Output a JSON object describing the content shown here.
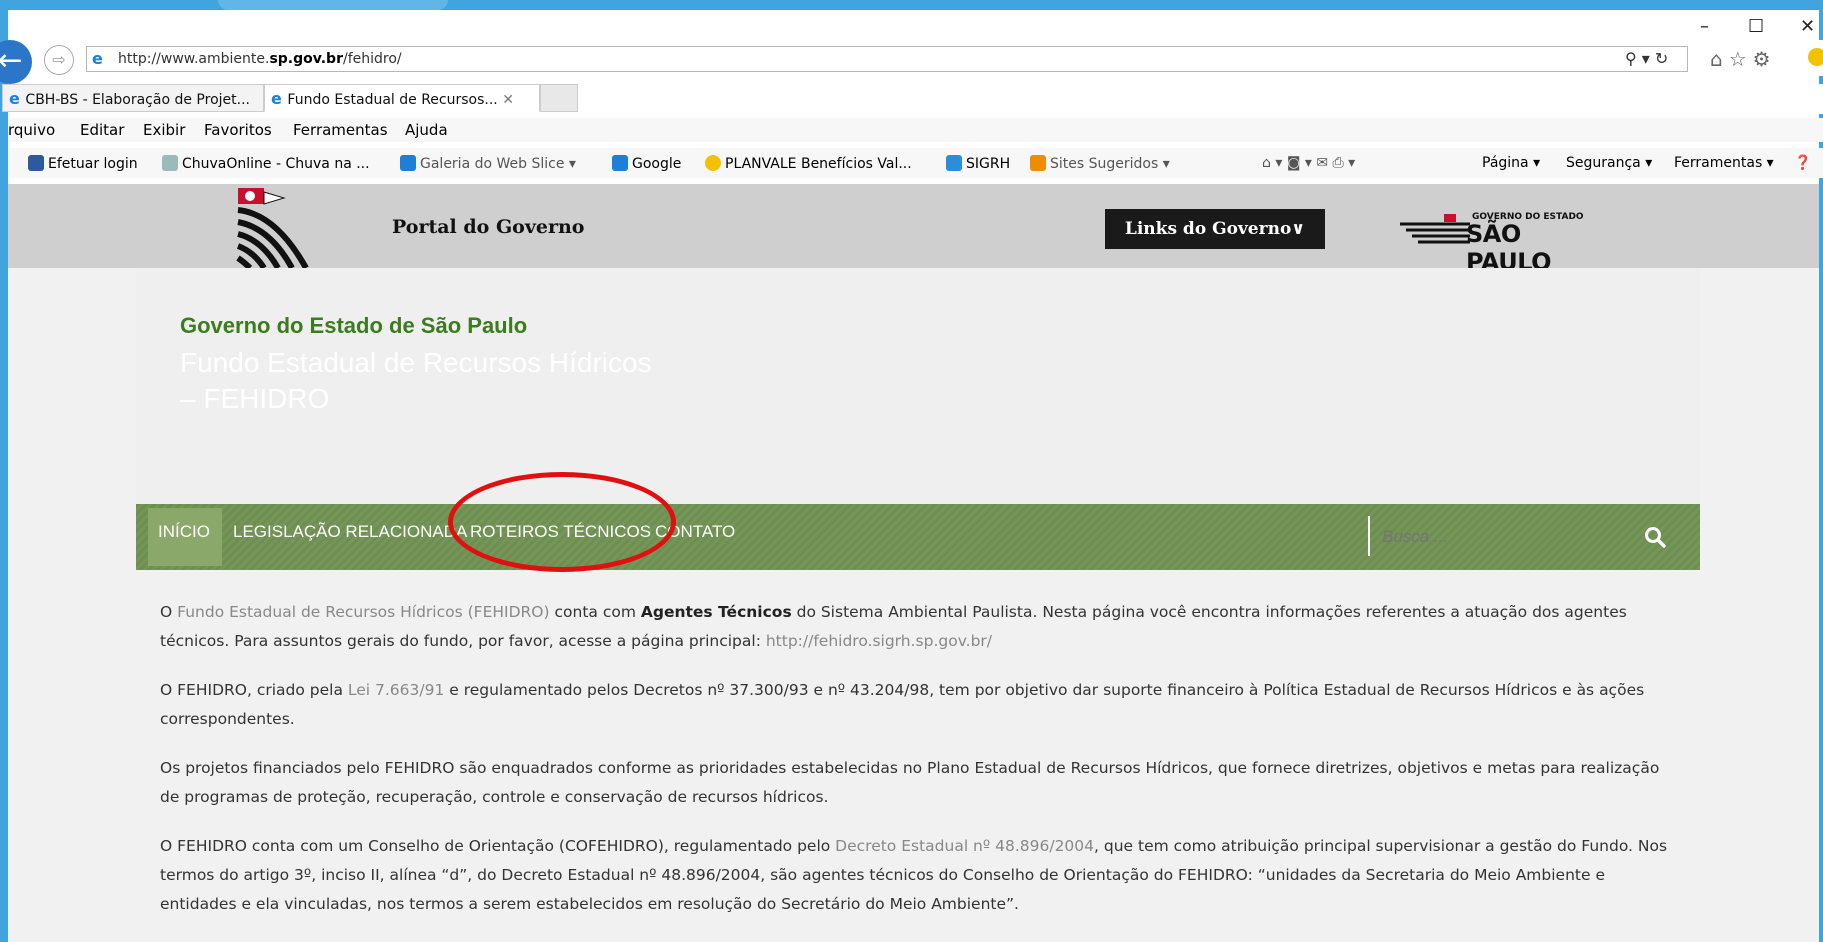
{
  "browser": {
    "url_prefix": "http://www.ambiente.",
    "url_bold": "sp.gov.br",
    "url_suffix": "/fehidro/",
    "address_tools": "⚲ ▾ ↻",
    "window_controls": {
      "minimize": "–",
      "maximize": "☐",
      "close": "✕"
    },
    "tabs": [
      {
        "label": "CBH-BS - Elaboração de Projet...",
        "active": false
      },
      {
        "label": "Fundo Estadual de Recursos...",
        "active": true
      }
    ],
    "menu": [
      "rquivo",
      "Editar",
      "Exibir",
      "Favoritos",
      "Ferramentas",
      "Ajuda"
    ],
    "favorites": [
      "Efetuar login",
      "ChuvaOnline - Chuva na ...",
      "Galeria do Web Slice ▾",
      "Google",
      "PLANVALE Benefícios  Val...",
      "SIGRH",
      "Sites Sugeridos ▾"
    ],
    "command_bar": [
      "Página ▾",
      "Segurança ▾",
      "Ferramentas ▾"
    ]
  },
  "govbar": {
    "portal_label": "Portal do Governo",
    "links_label": "Links do Governo∨",
    "logo_small": "GOVERNO DO ESTADO",
    "logo_big": "SÃO PAULO"
  },
  "site": {
    "org": "Governo do Estado de São Paulo",
    "title_line1": "Fundo Estadual de Recursos Hídricos",
    "title_line2": "– FEHIDRO"
  },
  "nav": {
    "items": [
      "INÍCIO",
      "LEGISLAÇÃO RELACIONADA",
      "ROTEIROS TÉCNICOS",
      "CONTATO"
    ],
    "search_placeholder": "Busca ..."
  },
  "content": {
    "p1": {
      "pre": "O ",
      "link": "Fundo Estadual de Recursos Hídricos (FEHIDRO)",
      "mid": "  conta com ",
      "bold": "Agentes Técnicos",
      "post": " do Sistema Ambiental Paulista. Nesta página você encontra informações referentes a atuação dos agentes técnicos. Para assuntos gerais do fundo, por favor, acesse a página principal: ",
      "link2": "http://fehidro.sigrh.sp.gov.br/"
    },
    "p2": {
      "pre": "O FEHIDRO, criado pela ",
      "link": "Lei 7.663/91",
      "post": " e regulamentado pelos Decretos nº 37.300/93 e nº 43.204/98, tem por objetivo dar suporte financeiro à Política Estadual de Recursos Hídricos e às ações correspondentes."
    },
    "p3": "Os projetos financiados pelo FEHIDRO são enquadrados conforme as prioridades estabelecidas no Plano Estadual de Recursos Hídricos, que fornece diretrizes, objetivos e metas para realização de programas de proteção, recuperação, controle e conservação de recursos hídricos.",
    "p4": {
      "pre": "O FEHIDRO conta com um Conselho de Orientação (COFEHIDRO), regulamentado pelo ",
      "link": "Decreto Estadual nº 48.896/2004",
      "post": ", que tem como atribuição principal supervisionar a gestão do Fundo. Nos termos do artigo 3º, inciso II, alínea “d”, do Decreto Estadual nº 48.896/2004, são agentes técnicos do Conselho de Orientação do FEHIDRO: “unidades da Secretaria do Meio Ambiente e entidades e ela vinculadas, nos termos a serem estabelecidos em resolução do Secretário do Meio Ambiente”."
    }
  },
  "colors": {
    "accent_green": "#3a7d1c",
    "nav_green": "#6e8f4f",
    "annotation_red": "#e01010",
    "ie_blue": "#41a4de"
  }
}
